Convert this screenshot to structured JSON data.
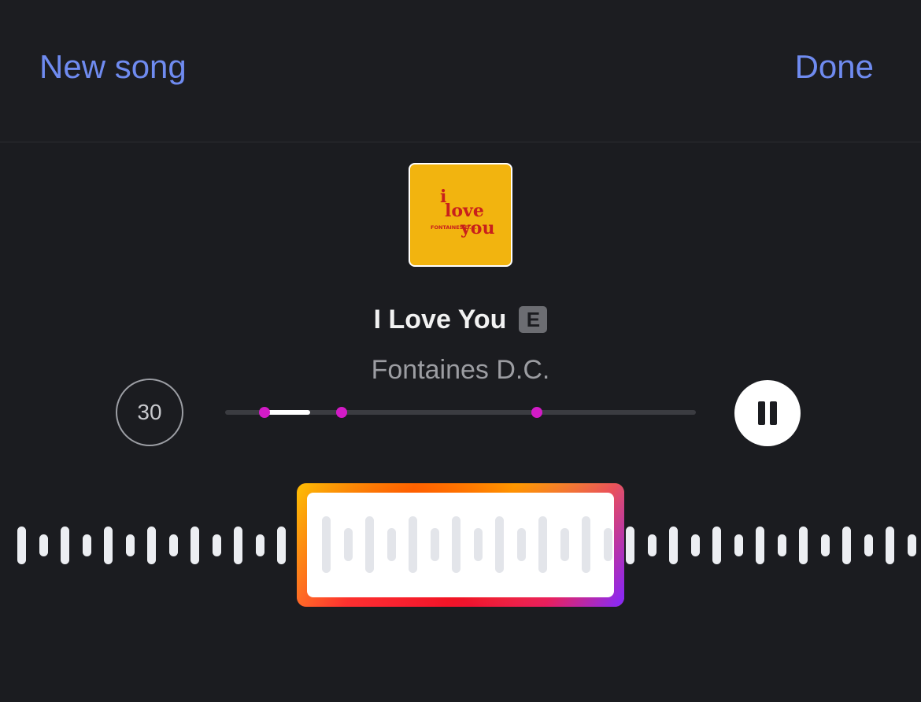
{
  "header": {
    "left_button": "New song",
    "right_button": "Done"
  },
  "album": {
    "art_text_1": "i",
    "art_text_2": "love",
    "art_text_3": "you",
    "art_text_4": "FONTAINES D.C.",
    "art_color": "#f2b40f",
    "art_text_color": "#c8201c"
  },
  "song": {
    "title": "I Love You",
    "explicit_badge": "E",
    "artist": "Fontaines D.C."
  },
  "controls": {
    "duration_label": "30",
    "play_state": "playing",
    "pause_icon": "pause-icon"
  },
  "colors": {
    "accent": "#6f8bf0",
    "background": "#1b1c20",
    "marker": "#d21bc6"
  }
}
